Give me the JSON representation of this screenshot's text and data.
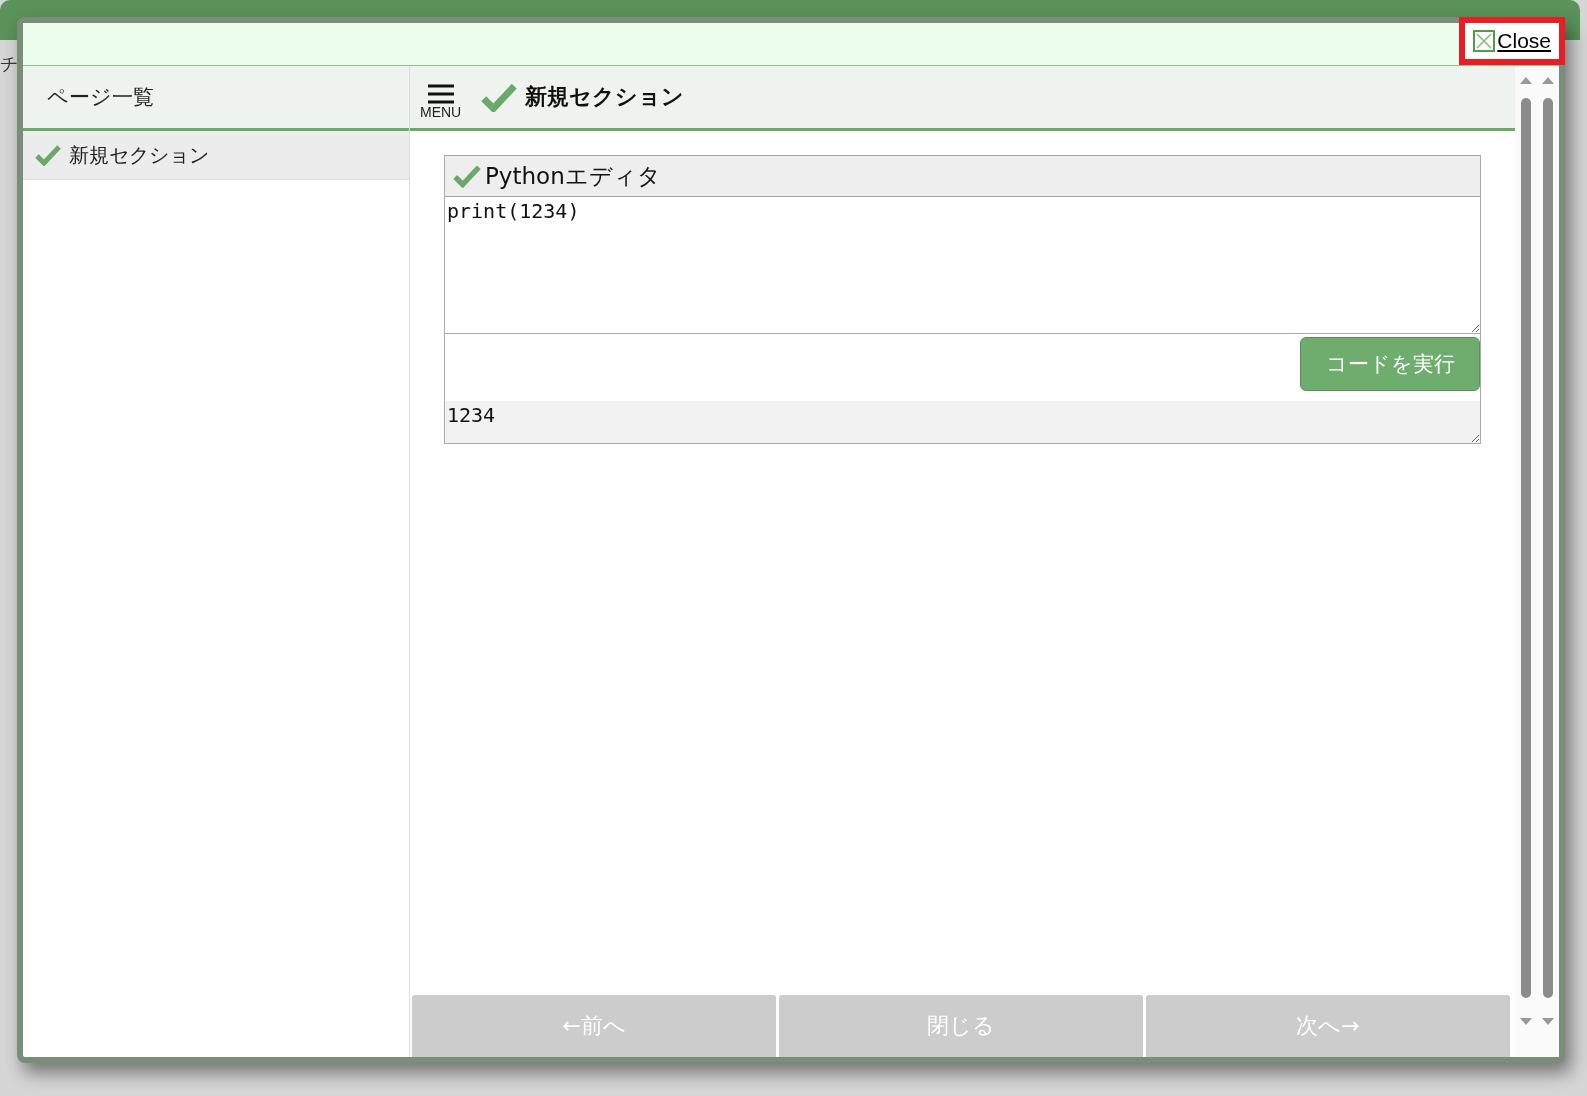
{
  "background_page": {
    "fragment": "チ"
  },
  "dialog": {
    "close_link": "Close"
  },
  "sidebar": {
    "title": "ページ一覧",
    "items": [
      {
        "label": "新規セクション",
        "checked": true,
        "selected": true
      }
    ]
  },
  "main": {
    "menu_label": "MENU",
    "section_title": "新規セクション",
    "section_checked": true,
    "editor": {
      "title": "Pythonエディタ",
      "checked": true,
      "code": "print(1234)",
      "run_button": "コードを実行",
      "output": "1234"
    }
  },
  "footer_buttons": [
    {
      "label": "←前へ",
      "disabled": true
    },
    {
      "label": "閉じる",
      "disabled": true
    },
    {
      "label": "次へ→",
      "disabled": true
    }
  ]
}
